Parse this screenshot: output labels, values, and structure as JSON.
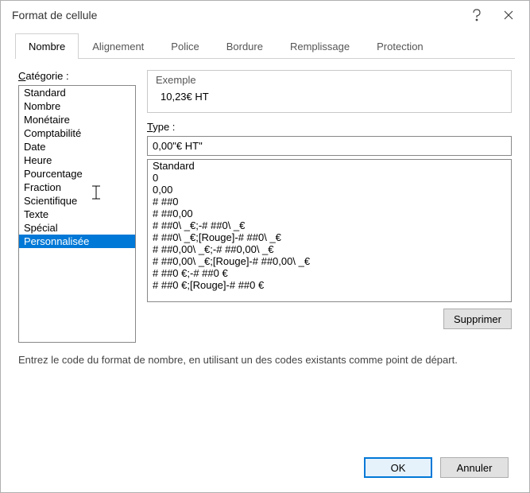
{
  "window": {
    "title": "Format de cellule"
  },
  "tabs": [
    "Nombre",
    "Alignement",
    "Police",
    "Bordure",
    "Remplissage",
    "Protection"
  ],
  "category": {
    "label": "Catégorie :",
    "items": [
      "Standard",
      "Nombre",
      "Monétaire",
      "Comptabilité",
      "Date",
      "Heure",
      "Pourcentage",
      "Fraction",
      "Scientifique",
      "Texte",
      "Spécial",
      "Personnalisée"
    ],
    "selected_index": 11
  },
  "example": {
    "label": "Exemple",
    "value": "10,23€ HT"
  },
  "type": {
    "label": "Type :",
    "input_value": "0,00\"€ HT\"",
    "list": [
      "Standard",
      "0",
      "0,00",
      "# ##0",
      "# ##0,00",
      "# ##0\\ _€;-# ##0\\ _€",
      "# ##0\\ _€;[Rouge]-# ##0\\ _€",
      "# ##0,00\\ _€;-# ##0,00\\ _€",
      "# ##0,00\\ _€;[Rouge]-# ##0,00\\ _€",
      "# ##0 €;-# ##0 €",
      "# ##0 €;[Rouge]-# ##0 €"
    ]
  },
  "buttons": {
    "delete": "Supprimer",
    "ok": "OK",
    "cancel": "Annuler"
  },
  "hint": "Entrez le code du format de nombre, en utilisant un des codes existants comme point de départ."
}
